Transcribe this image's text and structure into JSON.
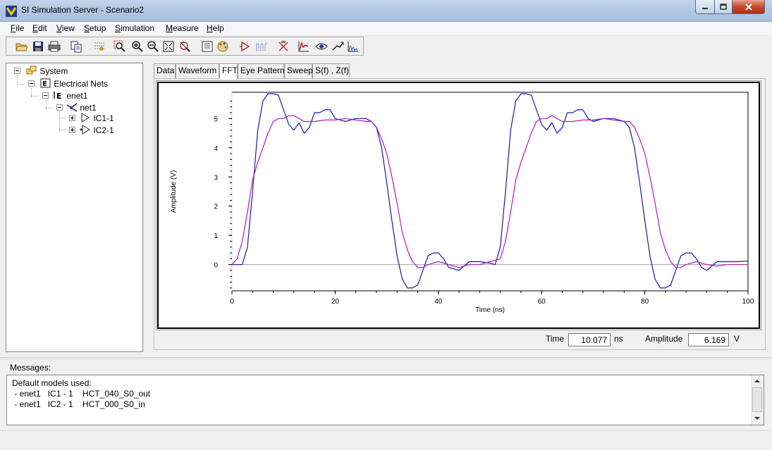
{
  "window": {
    "title": "SI Simulation Server - Scenario2"
  },
  "menu": {
    "items": [
      {
        "label": "File",
        "ul": "F",
        "rest": "ile"
      },
      {
        "label": "Edit",
        "ul": "E",
        "rest": "dit"
      },
      {
        "label": "View",
        "ul": "V",
        "rest": "iew"
      },
      {
        "label": "Setup",
        "ul": "S",
        "rest": "etup"
      },
      {
        "label": "Simulation",
        "ul": "S",
        "rest": "imulation"
      },
      {
        "label": "Measure",
        "ul": "M",
        "rest": "easure"
      },
      {
        "label": "Help",
        "ul": "H",
        "rest": "elp"
      }
    ]
  },
  "tree": {
    "nodes": [
      {
        "label": "System"
      },
      {
        "label": "Electrical Nets"
      },
      {
        "label": "enet1"
      },
      {
        "label": "net1"
      },
      {
        "label": "IC1-1"
      },
      {
        "label": "IC2-1"
      }
    ]
  },
  "tabs": [
    {
      "label": "Data"
    },
    {
      "label": "Waveform"
    },
    {
      "label": "FFT"
    },
    {
      "label": "Eye Pattern"
    },
    {
      "label": "Sweep"
    },
    {
      "label": "S(f) , Z(f)"
    }
  ],
  "active_tab": "FFT",
  "readout": {
    "time_label": "Time",
    "time_value": "10.077",
    "time_unit": "ns",
    "amplitude_label": "Amplitude",
    "amplitude_value": "6.169",
    "amplitude_unit": "V"
  },
  "messages": {
    "label": "Messages:",
    "lines": [
      "Default models used:",
      " - enet1   IC1 - 1    HCT_040_S0_out",
      " - enet1   IC2 - 1    HCT_000_S0_in"
    ]
  },
  "colors": {
    "series_blue": "#1a1aa8",
    "series_purple": "#b01cb8"
  },
  "chart_data": {
    "type": "line",
    "title": "",
    "xlabel": "Time (ns)",
    "ylabel": "Amplitude (V)",
    "xlim": [
      0,
      100
    ],
    "ylim": [
      -0.9,
      5.9
    ],
    "xticks": [
      0,
      20,
      40,
      60,
      80,
      100
    ],
    "yticks": [
      0,
      1,
      2,
      3,
      4,
      5
    ],
    "grid": false,
    "series": [
      {
        "color": "#1a1aa8",
        "x": [
          0,
          2,
          3,
          4,
          5,
          6,
          7,
          8,
          9,
          10,
          11,
          12,
          13,
          14,
          15,
          16,
          17,
          18,
          19,
          20,
          22,
          24,
          26,
          27,
          28,
          29,
          30,
          31,
          32,
          33,
          34,
          35,
          36,
          37,
          38,
          39,
          40,
          41,
          42,
          44,
          46,
          48,
          50,
          51,
          52,
          53,
          54,
          55,
          56,
          57,
          58,
          59,
          60,
          61,
          62,
          63,
          64,
          65,
          66,
          67,
          68,
          69,
          70,
          72,
          74,
          76,
          77,
          78,
          79,
          80,
          81,
          82,
          83,
          84,
          85,
          86,
          87,
          88,
          89,
          90,
          91,
          92,
          94,
          96,
          98,
          100
        ],
        "y": [
          0,
          0,
          0.6,
          2.5,
          4.6,
          5.6,
          5.85,
          5.85,
          5.8,
          5.3,
          4.8,
          4.6,
          4.85,
          4.5,
          4.7,
          5.2,
          5.2,
          5.3,
          5.3,
          5.0,
          4.9,
          5.0,
          5.0,
          4.9,
          4.7,
          4.0,
          2.8,
          1.5,
          0.3,
          -0.5,
          -0.8,
          -0.8,
          -0.7,
          -0.2,
          0.3,
          0.4,
          0.4,
          0.2,
          -0.1,
          -0.2,
          0.1,
          0.1,
          0.05,
          0,
          0.6,
          2.5,
          4.6,
          5.6,
          5.85,
          5.85,
          5.8,
          5.3,
          4.8,
          4.6,
          4.85,
          4.5,
          4.7,
          5.2,
          5.2,
          5.3,
          5.3,
          5.0,
          4.9,
          5.0,
          5.0,
          4.9,
          4.7,
          4.0,
          2.8,
          1.5,
          0.3,
          -0.5,
          -0.8,
          -0.8,
          -0.7,
          -0.2,
          0.3,
          0.4,
          0.4,
          0.2,
          -0.1,
          -0.2,
          0.1,
          0.1,
          0.1,
          0.12
        ]
      },
      {
        "color": "#b01cb8",
        "x": [
          0,
          1,
          2,
          3,
          4,
          5,
          6,
          7,
          8,
          9,
          10,
          11,
          12,
          14,
          16,
          18,
          20,
          22,
          24,
          26,
          27,
          28,
          29,
          30,
          31,
          32,
          33,
          34,
          35,
          36,
          37,
          38,
          40,
          42,
          44,
          46,
          48,
          50,
          52,
          53,
          54,
          55,
          56,
          57,
          58,
          59,
          60,
          61,
          62,
          64,
          66,
          68,
          70,
          72,
          74,
          76,
          77,
          78,
          79,
          80,
          81,
          82,
          83,
          84,
          85,
          86,
          87,
          88,
          90,
          92,
          94,
          96,
          98,
          100
        ],
        "y": [
          0,
          0.2,
          0.8,
          1.8,
          2.9,
          3.5,
          4.0,
          4.5,
          4.9,
          5.0,
          5.0,
          5.1,
          5.1,
          4.9,
          4.9,
          4.95,
          4.95,
          5.0,
          4.95,
          4.9,
          4.9,
          4.7,
          4.3,
          3.8,
          3.0,
          2.1,
          1.1,
          0.5,
          0.1,
          -0.1,
          -0.1,
          0.0,
          0.1,
          0.0,
          -0.1,
          0.0,
          0.0,
          0.1,
          0.2,
          0.8,
          1.8,
          2.9,
          3.5,
          4.0,
          4.5,
          4.9,
          5.0,
          5.0,
          5.1,
          4.9,
          4.9,
          4.95,
          4.95,
          5.0,
          4.95,
          4.9,
          4.9,
          4.7,
          4.3,
          3.8,
          3.0,
          2.1,
          1.1,
          0.5,
          0.1,
          -0.1,
          -0.1,
          0.0,
          0.1,
          0.0,
          -0.05,
          0.0,
          0.0,
          0.0
        ]
      }
    ]
  }
}
